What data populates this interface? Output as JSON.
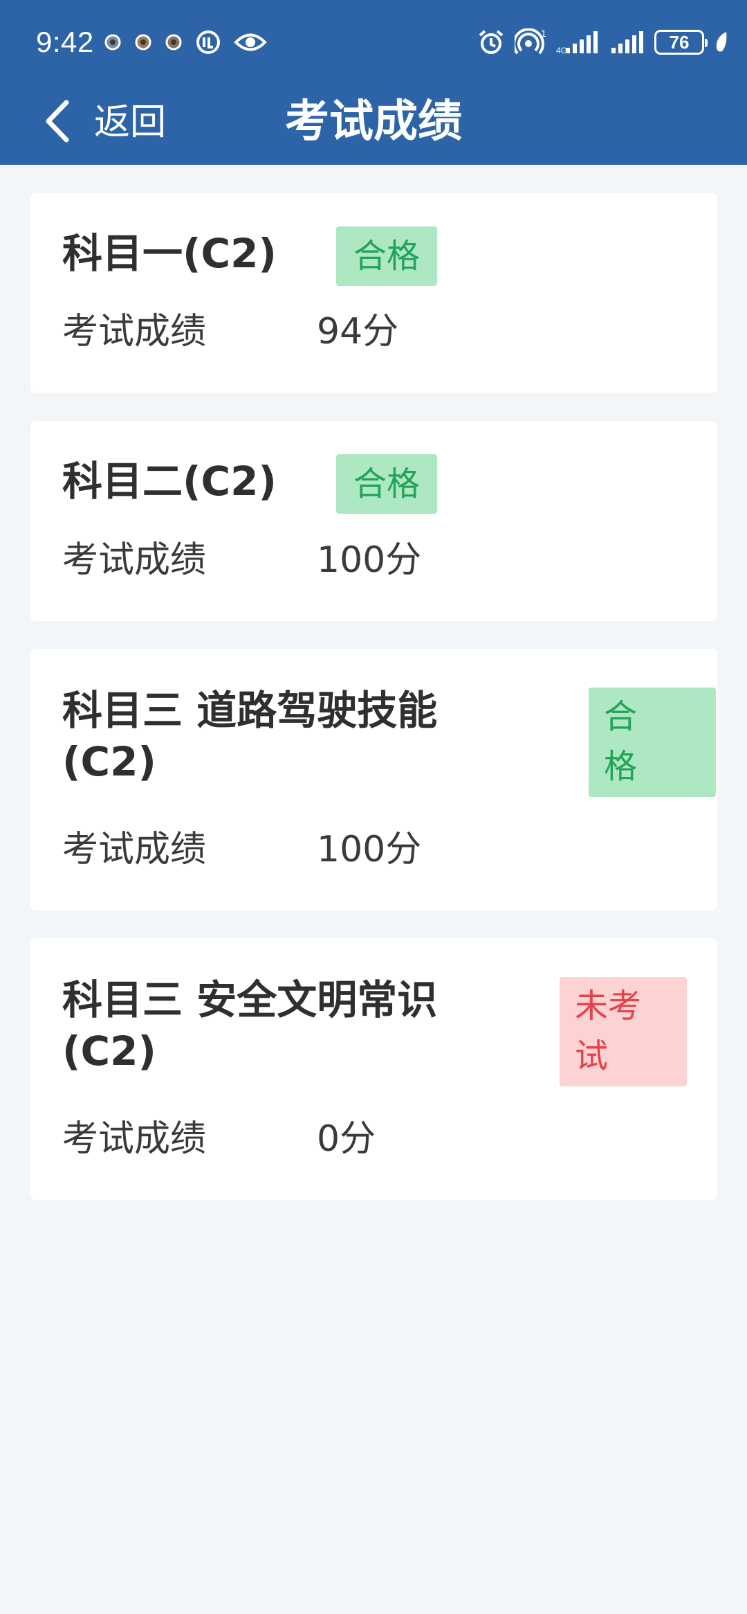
{
  "status_bar": {
    "time": "9:42",
    "battery": "76",
    "icons": [
      "notification-dot-icon",
      "notification-dot-icon",
      "notification-dot-icon",
      "vpn-icon",
      "eye-icon",
      "alarm-icon",
      "hotspot-icon",
      "signal-icon",
      "signal-icon",
      "battery-icon",
      "leaf-icon"
    ]
  },
  "nav": {
    "back_label": "返回",
    "title": "考试成绩"
  },
  "colors": {
    "header": "#2d64a8",
    "pass_bg": "#ade8c3",
    "pass_text": "#23a35a",
    "fail_bg": "#fcd2d3",
    "fail_text": "#e5434a"
  },
  "exams": [
    {
      "title": "科目一(C2)",
      "status": "合格",
      "score_label": "考试成绩",
      "score": "94分"
    },
    {
      "title": "科目二(C2)",
      "status": "合格",
      "score_label": "考试成绩",
      "score": "100分"
    },
    {
      "title": "科目三 道路驾驶技能(C2)",
      "status_lines": [
        "合",
        "格"
      ],
      "score_label": "考试成绩",
      "score": "100分"
    },
    {
      "title": "科目三 安全文明常识(C2)",
      "status_lines": [
        "未考",
        "试"
      ],
      "score_label": "考试成绩",
      "score": "0分"
    }
  ]
}
